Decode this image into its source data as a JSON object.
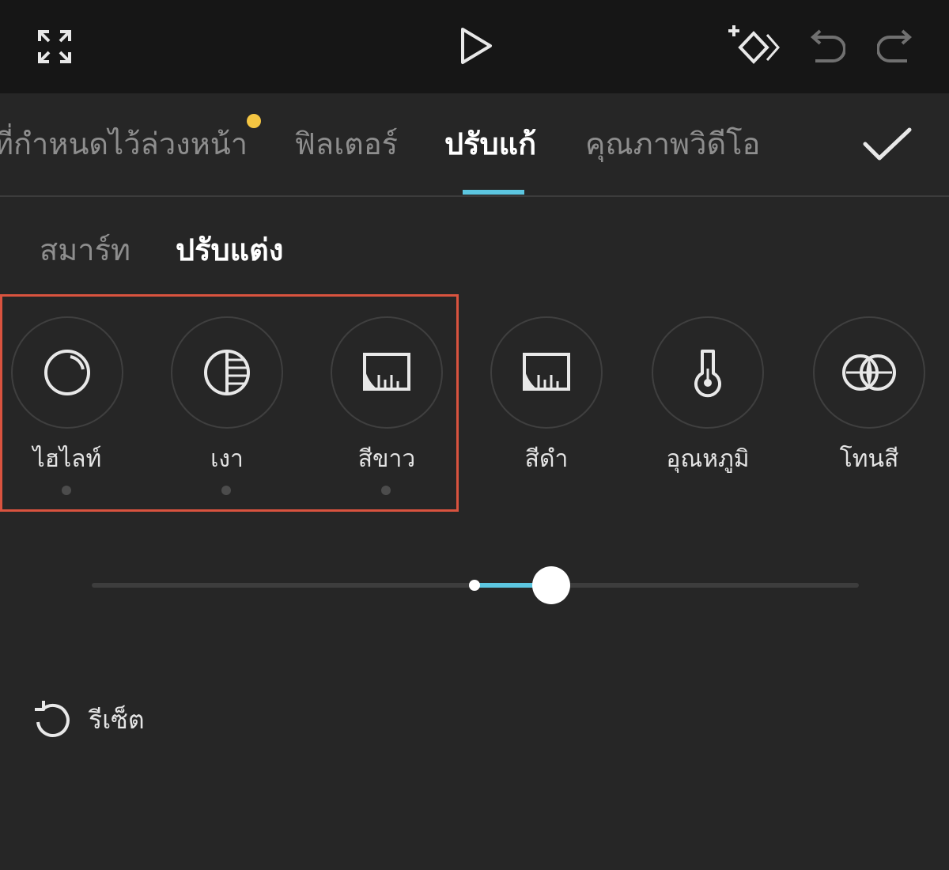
{
  "topbar": {
    "icons": [
      "fullscreen-icon",
      "play-icon",
      "add-keyframe-icon",
      "undo-icon",
      "redo-icon"
    ]
  },
  "tabs": {
    "items": [
      "ที่กำหนดไว้ล่วงหน้า",
      "ฟิลเตอร์",
      "ปรับแก้",
      "คุณภาพวิดีโอ"
    ],
    "active": "ปรับแก้"
  },
  "subtabs": {
    "items": [
      "สมาร์ท",
      "ปรับแต่ง"
    ],
    "active": "ปรับแต่ง"
  },
  "tools": [
    {
      "label": "ไฮไลท์",
      "icon": "highlight-icon"
    },
    {
      "label": "เงา",
      "icon": "shadow-icon"
    },
    {
      "label": "สีขาว",
      "icon": "whites-icon"
    },
    {
      "label": "สีดำ",
      "icon": "blacks-icon"
    },
    {
      "label": "อุณหภูมิ",
      "icon": "temperature-icon"
    },
    {
      "label": "โทนสี",
      "icon": "tint-icon"
    }
  ],
  "slider": {
    "value_fraction": 0.6
  },
  "reset": {
    "label": "รีเซ็ต"
  },
  "colors": {
    "accent": "#5cc6e0",
    "highlight_border": "#d9533f",
    "new_dot": "#f4c542"
  }
}
